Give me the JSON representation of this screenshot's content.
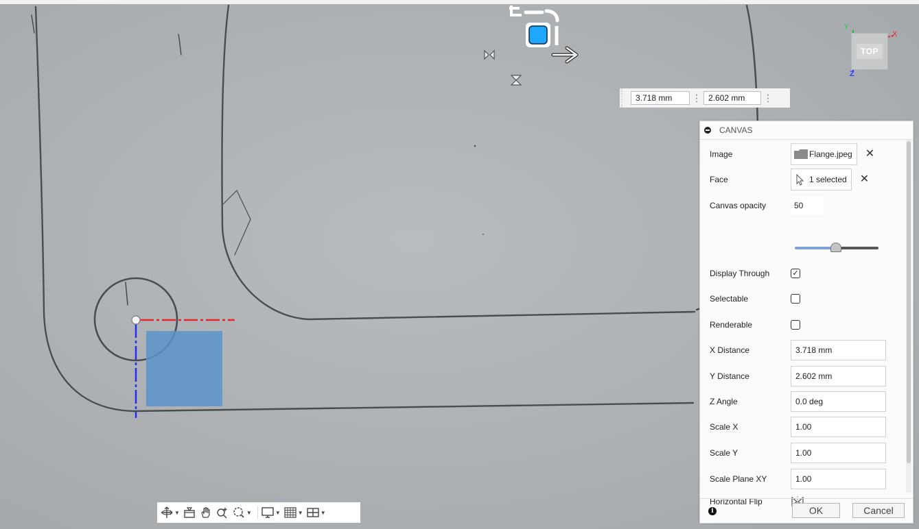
{
  "dimension_readout": {
    "x_value": "3.718 mm",
    "y_value": "2.602 mm"
  },
  "viewcube": {
    "face_label": "TOP",
    "axis_x": "X",
    "axis_y": "Y",
    "axis_z": "Z"
  },
  "panel": {
    "title": "CANVAS",
    "image": {
      "label": "Image",
      "value": "Flange.jpeg"
    },
    "face": {
      "label": "Face",
      "value": "1 selected"
    },
    "canvas_opacity": {
      "label": "Canvas opacity",
      "value": "50",
      "slider_fraction": 0.5
    },
    "display_through": {
      "label": "Display Through",
      "checked": true
    },
    "selectable": {
      "label": "Selectable",
      "checked": false
    },
    "renderable": {
      "label": "Renderable",
      "checked": false
    },
    "x_distance": {
      "label": "X Distance",
      "value": "3.718 mm"
    },
    "y_distance": {
      "label": "Y Distance",
      "value": "2.602 mm"
    },
    "z_angle": {
      "label": "Z Angle",
      "value": "0.0 deg"
    },
    "scale_x": {
      "label": "Scale X",
      "value": "1.00"
    },
    "scale_y": {
      "label": "Scale Y",
      "value": "1.00"
    },
    "scale_plane_xy": {
      "label": "Scale Plane XY",
      "value": "1.00"
    },
    "horizontal_flip": {
      "label": "Horizontal Flip"
    },
    "ok_label": "OK",
    "cancel_label": "Cancel"
  },
  "toolbar": {
    "tools": [
      "orbit-icon",
      "look-at-icon",
      "pan-icon",
      "zoom-icon",
      "fit-icon",
      "display-settings-icon",
      "grid-icon",
      "viewports-icon"
    ]
  },
  "colors": {
    "selection_blue": "#1ea7ff",
    "overlay_blue": "#5b93c9",
    "x_axis_red": "#e8262c",
    "y_axis_blue": "#1f2cff",
    "slider_blue": "#7fa3d9"
  }
}
